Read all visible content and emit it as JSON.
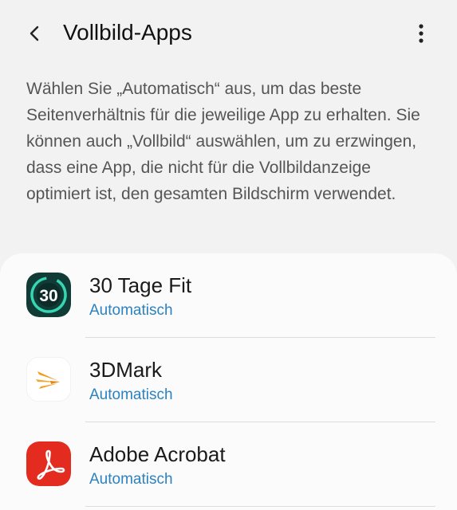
{
  "header": {
    "title": "Vollbild-Apps",
    "back_icon": "back-arrow-icon",
    "more_icon": "more-vertical-icon"
  },
  "description": "Wählen Sie „Automatisch“ aus, um das beste Seitenverhältnis für die jeweilige App zu erhalten. Sie können auch „Vollbild“ auswählen, um zu erzwingen, dass eine App, die nicht für die Vollbildanzeige optimiert ist, den gesamten Bildschirm verwendet.",
  "apps": [
    {
      "name": "30 Tage Fit",
      "mode": "Automatisch",
      "icon": "30-day-fit-app-icon",
      "icon_label": "30"
    },
    {
      "name": "3DMark",
      "mode": "Automatisch",
      "icon": "3dmark-app-icon"
    },
    {
      "name": "Adobe Acrobat",
      "mode": "Automatisch",
      "icon": "adobe-acrobat-app-icon"
    }
  ],
  "colors": {
    "background": "#f2f2f2",
    "card": "#fbfbfb",
    "accent": "#2b82c0",
    "fit_icon_bg": "#103b36",
    "fit_icon_ring": "#37d6b3",
    "acrobat_red": "#e32b20",
    "dmark_orange": "#f39b1e"
  }
}
